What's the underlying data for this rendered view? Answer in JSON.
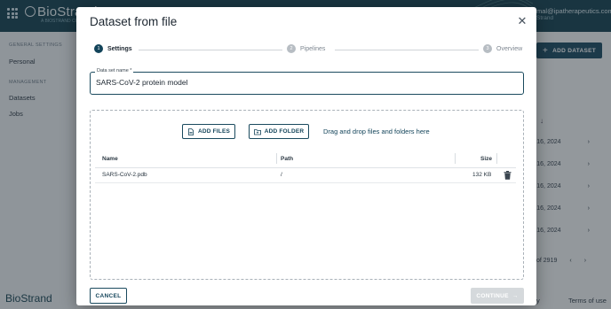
{
  "background": {
    "logo": "BioStrand",
    "logo_tag": "A BIOSTRAND COMPANY",
    "user_email": "mal@ipatherapeutics.com",
    "user_org": "Strand",
    "sidebar": {
      "general_heading": "GENERAL SETTINGS",
      "personal": "Personal",
      "management_heading": "MANAGEMENT",
      "datasets": "Datasets",
      "jobs": "Jobs"
    },
    "footer_logo": "BioStrand",
    "add_dataset_label": "ADD DATASET",
    "rows": [
      "r 16, 2024",
      "r 16, 2024",
      "r 16, 2024",
      "r 16, 2024",
      "r 16, 2024"
    ],
    "pager_text": "of 2919",
    "terms": "Terms of use",
    "footer_fragment": "y"
  },
  "modal": {
    "title": "Dataset from file",
    "steps": [
      {
        "num": "1",
        "label": "Settings",
        "active": true
      },
      {
        "num": "2",
        "label": "Pipelines",
        "active": false
      },
      {
        "num": "3",
        "label": "Overview",
        "active": false
      }
    ],
    "name_field": {
      "label": "Data set name *",
      "value": "SARS-CoV-2 protein model"
    },
    "add_files_label": "ADD FILES",
    "add_folder_label": "ADD FOLDER",
    "drag_text": "Drag and drop files and folders here",
    "table": {
      "headers": [
        "Name",
        "Path",
        "Size"
      ],
      "rows": [
        {
          "name": "SARS-CoV-2.pdb",
          "path": "/",
          "size": "132 KB"
        }
      ]
    },
    "cancel_label": "CANCEL",
    "continue_label": "CONTINUE"
  },
  "colors": {
    "primary": "#13445a",
    "disabled": "#d5d9dc",
    "overlay": "#283038"
  }
}
